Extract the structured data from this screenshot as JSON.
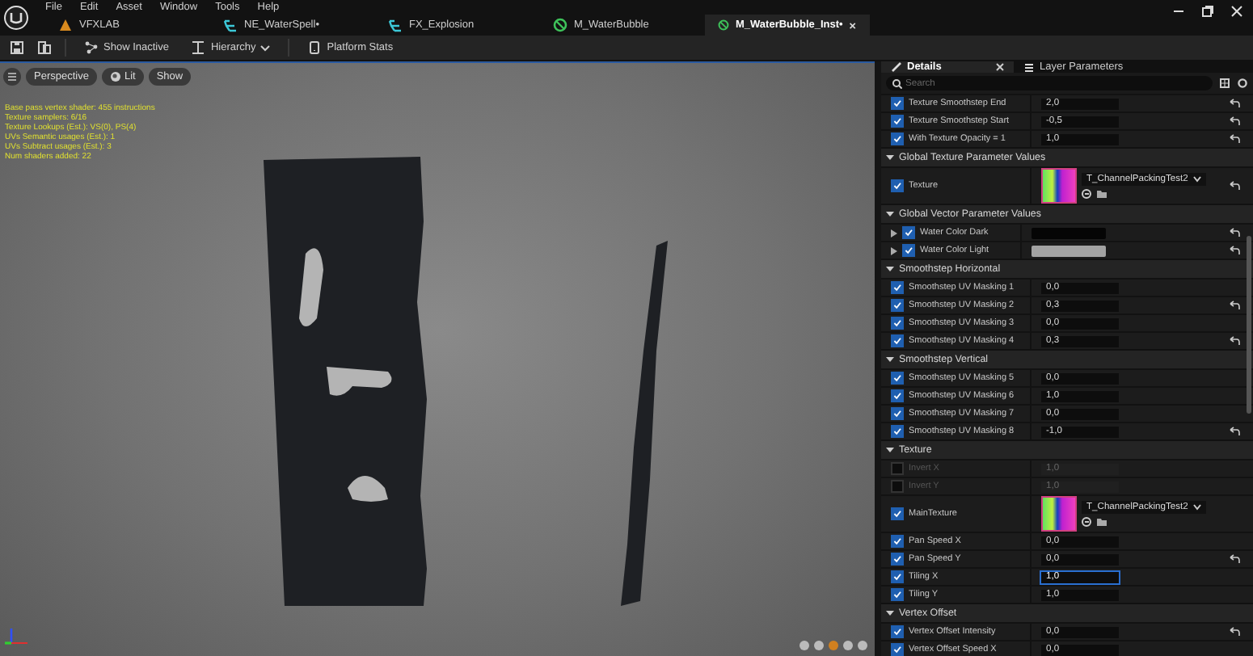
{
  "menu": [
    "File",
    "Edit",
    "Asset",
    "Window",
    "Tools",
    "Help"
  ],
  "tabs": [
    {
      "label": "VFXLAB",
      "kind": "level",
      "selected": false
    },
    {
      "label": "NE_WaterSpell•",
      "kind": "niagara",
      "selected": false
    },
    {
      "label": "FX_Explosion",
      "kind": "niagara",
      "selected": false
    },
    {
      "label": "M_WaterBubble",
      "kind": "material",
      "selected": false
    },
    {
      "label": "M_WaterBubble_Inst•",
      "kind": "material",
      "selected": true
    }
  ],
  "toolbar": [
    {
      "label": "Show Inactive",
      "kind": "inactive"
    },
    {
      "label": "Hierarchy",
      "kind": "hierarchy"
    },
    {
      "label": "Platform Stats",
      "kind": "stats"
    }
  ],
  "viewport": {
    "buttons": [
      {
        "label": "Perspective",
        "kind": "plain"
      },
      {
        "label": "Lit",
        "kind": "lit"
      },
      {
        "label": "Show",
        "kind": "plain"
      }
    ],
    "stats": [
      "Base pass vertex shader: 455 instructions",
      "Texture samplers: 6/16",
      "Texture Lookups (Est.): VS(0), PS(4)",
      "UVs Semantic usages (Est.): 1",
      "UVs Subtract usages (Est.): 3",
      "Num shaders added: 22"
    ]
  },
  "details": {
    "tabs": [
      {
        "label": "Details",
        "selected": true
      },
      {
        "label": "Layer Parameters",
        "selected": false
      }
    ],
    "search": {
      "placeholder": "Search"
    },
    "sections": [
      {
        "rows": [
          {
            "kind": "number",
            "label": "Texture Smoothstep End",
            "checked": true,
            "disabled": false,
            "value": "2,0",
            "focused": false,
            "overridden": true
          },
          {
            "kind": "number",
            "label": "Texture Smoothstep Start",
            "checked": true,
            "disabled": false,
            "value": "-0,5",
            "focused": false,
            "overridden": true
          },
          {
            "kind": "number",
            "label": "With Texture Opacity = 1",
            "checked": true,
            "disabled": false,
            "value": "1,0",
            "focused": false,
            "overridden": true
          }
        ]
      },
      {
        "title": "Global Texture Parameter Values",
        "expanded": true,
        "rows": [
          {
            "kind": "texture",
            "label": "Texture",
            "checked": true,
            "disabled": false,
            "value": "T_ChannelPackingTest2",
            "overridden": true
          }
        ]
      },
      {
        "title": "Global Vector Parameter Values",
        "expanded": true,
        "rows": [
          {
            "kind": "color",
            "label": "Water Color Dark",
            "checked": true,
            "disabled": false,
            "color": "#050505",
            "overridden": true
          },
          {
            "kind": "color",
            "label": "Water Color Light",
            "checked": true,
            "disabled": false,
            "color": "#a3a3a3",
            "overridden": true
          }
        ]
      },
      {
        "title": "Smoothstep Horizontal",
        "expanded": true,
        "rows": [
          {
            "kind": "number",
            "label": "Smoothstep UV Masking 1",
            "checked": true,
            "disabled": false,
            "value": "0,0",
            "focused": false,
            "overridden": false
          },
          {
            "kind": "number",
            "label": "Smoothstep UV Masking 2",
            "checked": true,
            "disabled": false,
            "value": "0,3",
            "focused": false,
            "overridden": true
          },
          {
            "kind": "number",
            "label": "Smoothstep UV Masking 3",
            "checked": true,
            "disabled": false,
            "value": "0,0",
            "focused": false,
            "overridden": false
          },
          {
            "kind": "number",
            "label": "Smoothstep UV Masking 4",
            "checked": true,
            "disabled": false,
            "value": "0,3",
            "focused": false,
            "overridden": true
          }
        ]
      },
      {
        "title": "Smoothstep Vertical",
        "expanded": true,
        "rows": [
          {
            "kind": "number",
            "label": "Smoothstep UV Masking 5",
            "checked": true,
            "disabled": false,
            "value": "0,0",
            "focused": false,
            "overridden": false
          },
          {
            "kind": "number",
            "label": "Smoothstep UV Masking 6",
            "checked": true,
            "disabled": false,
            "value": "1,0",
            "focused": false,
            "overridden": false
          },
          {
            "kind": "number",
            "label": "Smoothstep UV Masking 7",
            "checked": true,
            "disabled": false,
            "value": "0,0",
            "focused": false,
            "overridden": false
          },
          {
            "kind": "number",
            "label": "Smoothstep UV Masking 8",
            "checked": true,
            "disabled": false,
            "value": "-1,0",
            "focused": false,
            "overridden": true
          }
        ]
      },
      {
        "title": "Texture",
        "expanded": true,
        "rows": [
          {
            "kind": "number",
            "label": "Invert X",
            "checked": false,
            "disabled": true,
            "value": "1,0",
            "focused": false,
            "overridden": false
          },
          {
            "kind": "number",
            "label": "Invert Y",
            "checked": false,
            "disabled": true,
            "value": "1,0",
            "focused": false,
            "overridden": false
          },
          {
            "kind": "texture",
            "label": "MainTexture",
            "checked": true,
            "disabled": false,
            "value": "T_ChannelPackingTest2",
            "overridden": false
          },
          {
            "kind": "number",
            "label": "Pan Speed X",
            "checked": true,
            "disabled": false,
            "value": "0,0",
            "focused": false,
            "overridden": false
          },
          {
            "kind": "number",
            "label": "Pan Speed Y",
            "checked": true,
            "disabled": false,
            "value": "0,0",
            "focused": false,
            "overridden": true
          },
          {
            "kind": "number",
            "label": "Tiling X",
            "checked": true,
            "disabled": false,
            "value": "1,0",
            "focused": true,
            "overridden": false
          },
          {
            "kind": "number",
            "label": "Tiling Y",
            "checked": true,
            "disabled": false,
            "value": "1,0",
            "focused": false,
            "overridden": false
          }
        ]
      },
      {
        "title": "Vertex Offset",
        "expanded": true,
        "rows": [
          {
            "kind": "number",
            "label": "Vertex Offset Intensity",
            "checked": true,
            "disabled": false,
            "value": "0,0",
            "focused": false,
            "overridden": true
          },
          {
            "kind": "number",
            "label": "Vertex Offset Speed X",
            "checked": true,
            "disabled": false,
            "value": "0,0",
            "focused": false,
            "overridden": false
          }
        ]
      }
    ]
  }
}
